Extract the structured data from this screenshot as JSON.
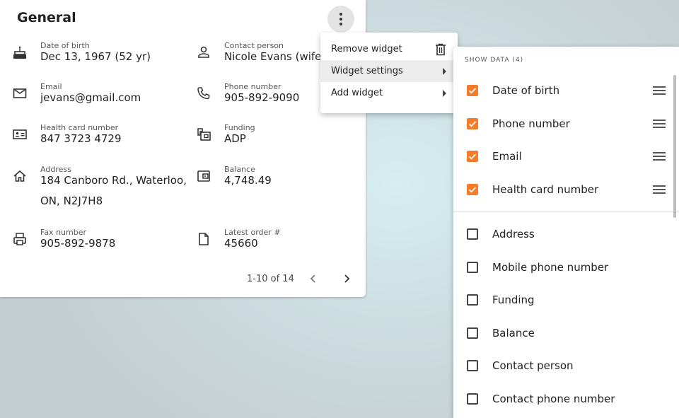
{
  "widget": {
    "title": "General",
    "fields": [
      {
        "label": "Date of birth",
        "value": "Dec 13, 1967 (52 yr)",
        "icon": "cake-icon"
      },
      {
        "label": "Contact person",
        "value": "Nicole Evans (wife)",
        "icon": "person-icon"
      },
      {
        "label": "Email",
        "value": "jevans@gmail.com",
        "icon": "mail-icon"
      },
      {
        "label": "Phone number",
        "value": "905-892-9090",
        "icon": "phone-icon"
      },
      {
        "label": "Health card number",
        "value": "847 3723 4729",
        "icon": "id-card-icon"
      },
      {
        "label": "Funding",
        "value": "ADP",
        "icon": "funding-icon"
      },
      {
        "label": "Address",
        "value_line1": "184 Canboro Rd., Waterloo,",
        "value_line2": "ON, N2J7H8",
        "icon": "home-icon"
      },
      {
        "label": "Balance",
        "value": "4,748.49",
        "icon": "wallet-icon"
      },
      {
        "label": "Fax number",
        "value": "905-892-9878",
        "icon": "fax-icon"
      },
      {
        "label": "Latest order #",
        "value": "45660",
        "icon": "document-icon"
      }
    ],
    "pagination": "1-10 of 14"
  },
  "context_menu": {
    "items": [
      {
        "label": "Remove widget",
        "icon": "trash-icon"
      },
      {
        "label": "Widget settings",
        "icon": "submenu-arrow-icon"
      },
      {
        "label": "Add widget",
        "icon": "submenu-arrow-icon"
      }
    ]
  },
  "settings_panel": {
    "header": "SHOW DATA (4)",
    "checked": [
      "Date of birth",
      "Phone number",
      "Email",
      "Health card number"
    ],
    "unchecked": [
      "Address",
      "Mobile phone number",
      "Funding",
      "Balance",
      "Contact person",
      "Contact phone number"
    ]
  },
  "colors": {
    "accent": "#f47b2a",
    "highlight": "#ececec"
  }
}
